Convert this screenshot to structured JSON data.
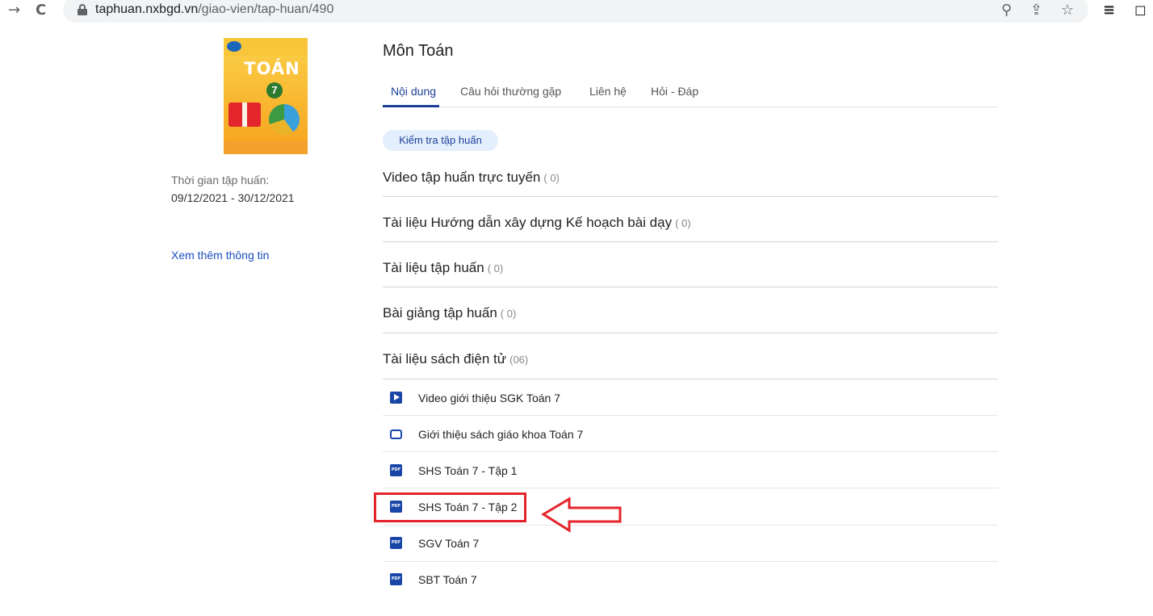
{
  "browser": {
    "back_glyph": "→",
    "reload_glyph": "C",
    "url_host": "taphuan.nxbgd.vn",
    "url_path": "/giao-vien/tap-huan/490",
    "zoom_glyph": "⚲",
    "share_glyph": "⇪",
    "bookmark_glyph": "☆",
    "reading_glyph": "≡",
    "window_glyph": "◻"
  },
  "sidebar": {
    "book_title": "TOÁN",
    "book_number": "7",
    "training_period_label": "Thời gian tập huấn:",
    "training_period_value": "09/12/2021 - 30/12/2021",
    "more_info_link": "Xem thêm thông tin"
  },
  "main": {
    "subject_title": "Môn Toán",
    "tabs": [
      {
        "label": "Nội dung",
        "active": true
      },
      {
        "label": "Câu hỏi thường gặp",
        "active": false
      },
      {
        "label": "Liên hệ",
        "active": false
      },
      {
        "label": "Hỏi - Đáp",
        "active": false
      }
    ],
    "check_training_chip": "Kiểm tra tập huấn",
    "sections": [
      {
        "title": "Video tập huấn trực tuyến",
        "count": "( 0)"
      },
      {
        "title": "Tài liệu Hướng dẫn xây dựng Kế hoạch bài dạy",
        "count": "( 0)"
      },
      {
        "title": "Tài liệu tập huấn",
        "count": "( 0)"
      },
      {
        "title": "Bài giảng tập huấn",
        "count": "( 0)"
      },
      {
        "title": "Tài liệu sách điện tử",
        "count": "(06)"
      }
    ],
    "ebook_items": [
      {
        "icon": "video-icon",
        "label": "Video giới thiệu SGK Toán 7"
      },
      {
        "icon": "slides-icon",
        "label": "Giới thiệu sách giáo khoa Toán 7"
      },
      {
        "icon": "pdf-icon",
        "icon_text": "PDF",
        "label": "SHS Toán 7 - Tập 1"
      },
      {
        "icon": "pdf-icon",
        "icon_text": "PDF",
        "label": "SHS Toán 7 - Tập 2"
      },
      {
        "icon": "pdf-icon",
        "icon_text": "PDF",
        "label": "SGV Toán 7"
      },
      {
        "icon": "pdf-icon",
        "icon_text": "PDF",
        "label": "SBT Toán 7"
      }
    ]
  },
  "annotation": {
    "color": "#e4242b",
    "highlighted_item": "SHS Toán 7 - Tập 2"
  },
  "colors": {
    "accent": "#1b3f99",
    "chip_bg": "#e4effd",
    "icon_blue": "#1a46a8"
  }
}
